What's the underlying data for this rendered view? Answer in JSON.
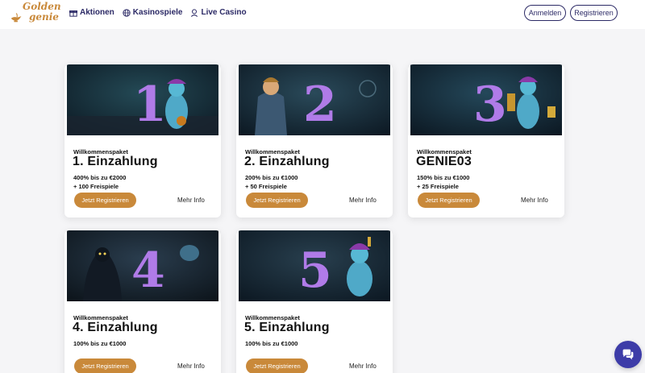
{
  "header": {
    "logo": {
      "line1": "Golden",
      "line2": "genie"
    },
    "nav": [
      {
        "label": "Aktionen",
        "icon": "gift-icon"
      },
      {
        "label": "Kasinospiele",
        "icon": "globe-icon"
      },
      {
        "label": "Live Casino",
        "icon": "dealer-icon"
      }
    ],
    "login_label": "Anmelden",
    "register_label": "Registrieren"
  },
  "colors": {
    "accent": "#c9893a",
    "brand": "#2c2a66",
    "chat": "#3d3ca8"
  },
  "cards": [
    {
      "kicker": "Willkommenspaket",
      "title": "1. Einzahlung",
      "offer": "400% bis zu €2000",
      "spins": "+ 100 Freispiele",
      "cta": "Jetzt Registrieren",
      "info": "Mehr Info",
      "numeral": "1"
    },
    {
      "kicker": "Willkommenspaket",
      "title": "2. Einzahlung",
      "offer": "200% bis zu €1000",
      "spins": "+ 50 Freispiele",
      "cta": "Jetzt Registrieren",
      "info": "Mehr Info",
      "numeral": "2"
    },
    {
      "kicker": "Willkommenspaket",
      "title": "GENIE03",
      "offer": "150% bis zu €1000",
      "spins": "+ 25 Freispiele",
      "cta": "Jetzt Registrieren",
      "info": "Mehr Info",
      "numeral": "3"
    },
    {
      "kicker": "Willkommenspaket",
      "title": "4. Einzahlung",
      "offer": "100% bis zu €1000",
      "spins": "",
      "cta": "Jetzt Registrieren",
      "info": "Mehr Info",
      "numeral": "4"
    },
    {
      "kicker": "Willkommenspaket",
      "title": "5. Einzahlung",
      "offer": "100% bis zu €1000",
      "spins": "",
      "cta": "Jetzt Registrieren",
      "info": "Mehr Info",
      "numeral": "5"
    }
  ]
}
